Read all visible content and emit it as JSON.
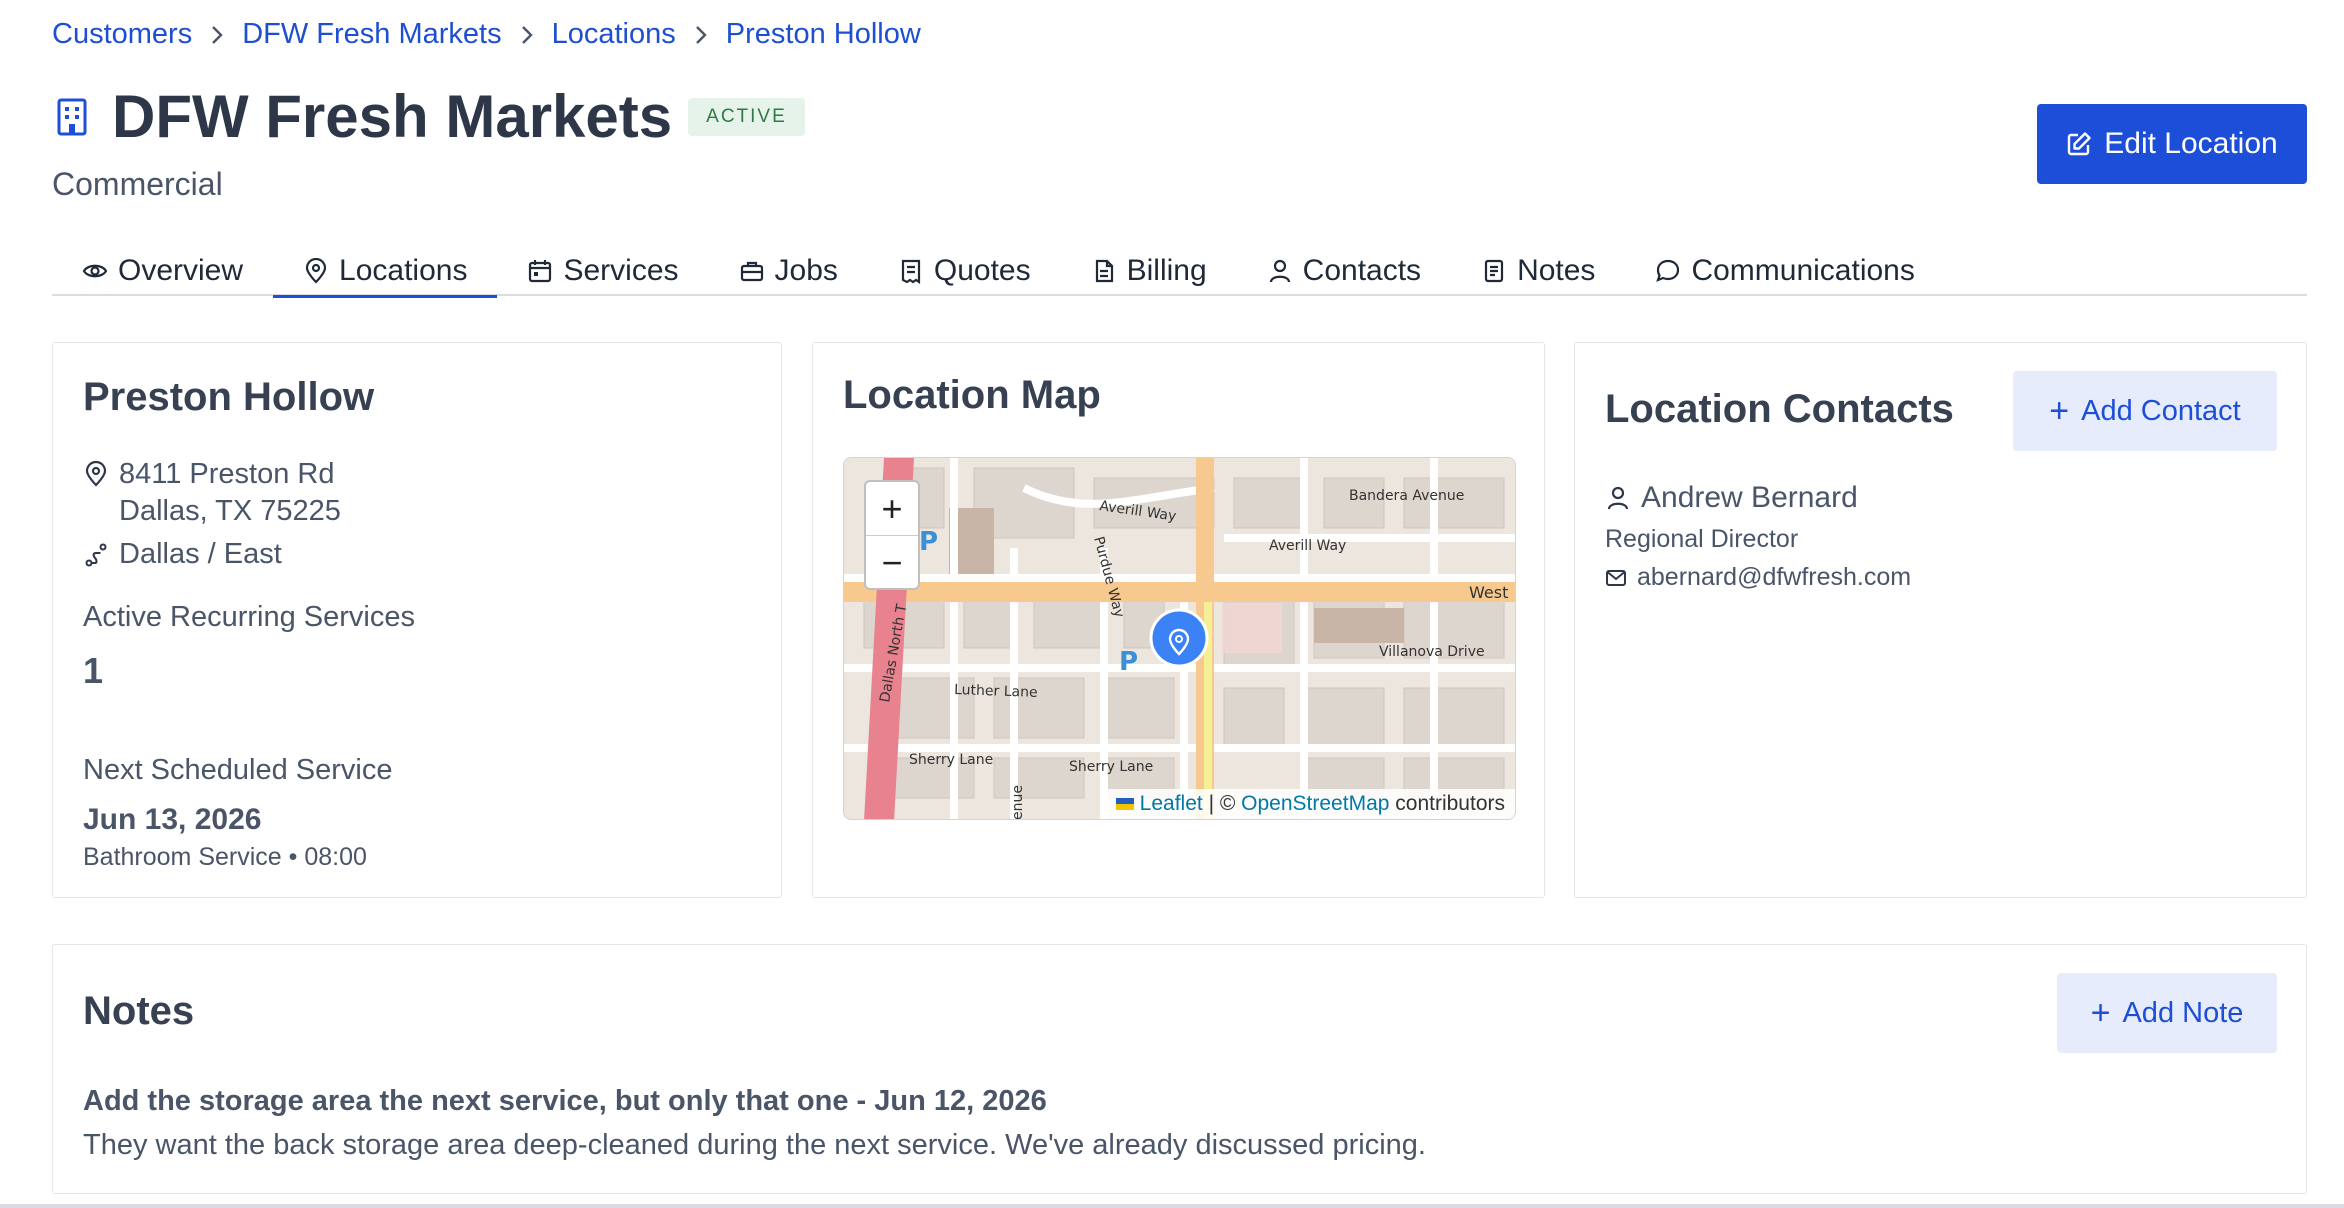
{
  "breadcrumb": [
    "Customers",
    "DFW Fresh Markets",
    "Locations",
    "Preston Hollow"
  ],
  "header": {
    "title": "DFW Fresh Markets",
    "status": "ACTIVE",
    "subtitle": "Commercial",
    "edit_label": "Edit Location"
  },
  "tabs": [
    {
      "label": "Overview",
      "icon": "eye-icon"
    },
    {
      "label": "Locations",
      "icon": "map-pin-icon",
      "active": true
    },
    {
      "label": "Services",
      "icon": "calendar-icon"
    },
    {
      "label": "Jobs",
      "icon": "briefcase-icon"
    },
    {
      "label": "Quotes",
      "icon": "receipt-icon"
    },
    {
      "label": "Billing",
      "icon": "file-icon"
    },
    {
      "label": "Contacts",
      "icon": "user-icon"
    },
    {
      "label": "Notes",
      "icon": "notes-icon"
    },
    {
      "label": "Communications",
      "icon": "chat-bubble-icon"
    }
  ],
  "location": {
    "name": "Preston Hollow",
    "address_line1": "8411 Preston Rd",
    "address_line2": "Dallas, TX 75225",
    "route": "Dallas / East",
    "active_services_label": "Active Recurring Services",
    "active_services_count": "1",
    "next_service_label": "Next Scheduled Service",
    "next_service_date": "Jun 13, 2026",
    "next_service_detail": "Bathroom Service • 08:00"
  },
  "map": {
    "title": "Location Map",
    "zoom_in": "+",
    "zoom_out": "−",
    "attribution_leaflet": "Leaflet",
    "attribution_sep": " | © ",
    "attribution_osm": "OpenStreetMap",
    "attribution_suffix": " contributors",
    "street_labels": [
      "Averill Way",
      "Bandera Avenue",
      "Averill Way",
      "West",
      "Villanova Drive",
      "Luther Lane",
      "Dallas North T",
      "Sherry Lane",
      "Sherry Lane",
      "Purdue Way",
      "enue"
    ],
    "parking_label": "P"
  },
  "contacts": {
    "title": "Location Contacts",
    "add_label": "Add Contact",
    "name": "Andrew Bernard",
    "role": "Regional Director",
    "email": "abernard@dfwfresh.com"
  },
  "notes": {
    "title": "Notes",
    "add_label": "Add Note",
    "note_title": "Add the storage area the next service, but only that one - Jun 12, 2026",
    "note_body": "They want the back storage area deep-cleaned during the next service. We've already discussed pricing."
  },
  "colors": {
    "primary": "#1c4ed8",
    "active_badge_bg": "#e6f3ea",
    "active_badge_text": "#2f7a45"
  }
}
